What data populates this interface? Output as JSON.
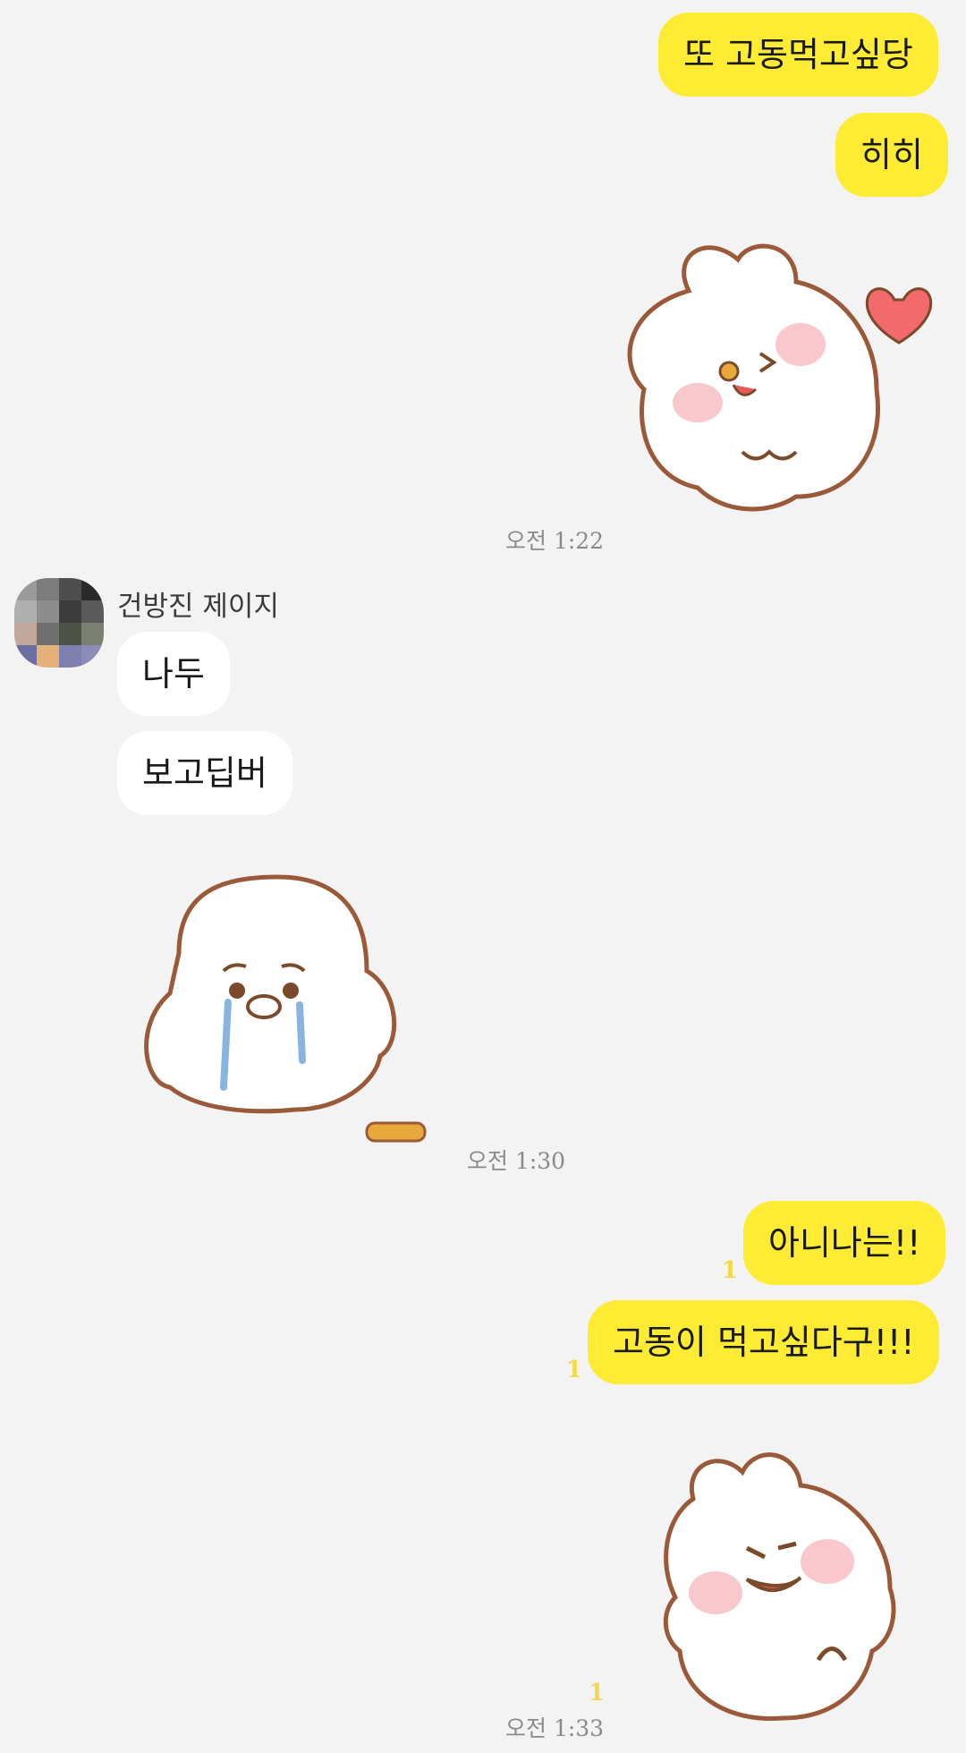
{
  "messages": {
    "me1": "또 고동먹고싶당",
    "me2": "히히",
    "time1": "오전 1:22",
    "sender_name": "건방진 제이지",
    "other1": "나두",
    "other2": "보고딥버",
    "time2": "오전 1:30",
    "me3": "아니나는!!",
    "me3_unread": "1",
    "me4": "고동이 먹고싶다구!!!",
    "me4_unread": "1",
    "sticker3_unread": "1",
    "time3": "오전 1:33"
  },
  "stickers": {
    "sticker1": "bunny-wink-heart-sticker",
    "sticker2": "crying-seal-sticker",
    "sticker3": "bunny-smug-sticker"
  },
  "colors": {
    "my_bubble": "#feeb34",
    "other_bubble": "#ffffff",
    "background": "#f3f3f3",
    "unread": "#f5d84a"
  }
}
